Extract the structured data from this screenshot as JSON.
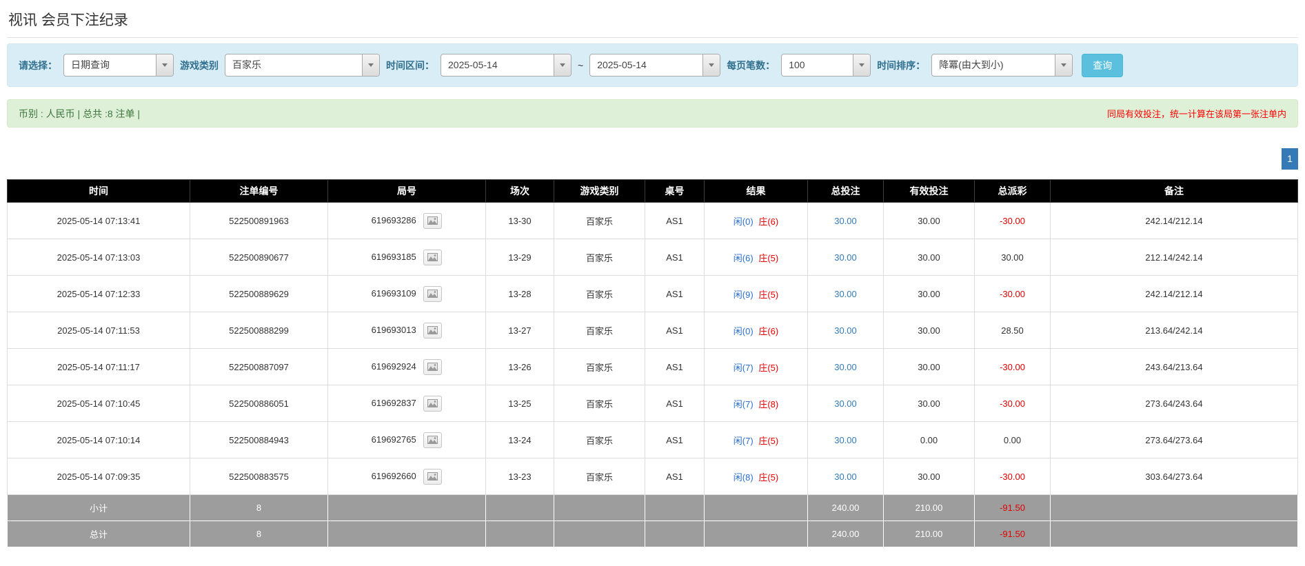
{
  "page": {
    "title": "视讯 会员下注纪录"
  },
  "filters": {
    "select_label": "请选择：",
    "select_value": "日期查询",
    "game_type_label": "游戏类别",
    "game_type_value": "百家乐",
    "date_range_label": "时间区间：",
    "date_from": "2025-05-14",
    "tilde": "~",
    "date_to": "2025-05-14",
    "per_page_label": "每页笔数：",
    "per_page_value": "100",
    "sort_label": "时间排序：",
    "sort_value": "降冪(由大到小)",
    "search_button": "查询"
  },
  "summary": {
    "left": "币别 : 人民币 | 总共 :8 注单 |",
    "right": "同局有效投注，统一计算在该局第一张注单内"
  },
  "pagination": {
    "current": "1"
  },
  "table": {
    "headers": [
      "时间",
      "注单编号",
      "局号",
      "场次",
      "游戏类别",
      "桌号",
      "结果",
      "总投注",
      "有效投注",
      "总派彩",
      "备注"
    ],
    "rows": [
      {
        "time": "2025-05-14 07:13:41",
        "bet_id": "522500891963",
        "round": "619693286",
        "session": "13-30",
        "game": "百家乐",
        "table_no": "AS1",
        "result_player": "闲(0)",
        "result_banker": "庄(6)",
        "total_bet": "30.00",
        "valid_bet": "30.00",
        "payout": "-30.00",
        "note": "242.14/212.14"
      },
      {
        "time": "2025-05-14 07:13:03",
        "bet_id": "522500890677",
        "round": "619693185",
        "session": "13-29",
        "game": "百家乐",
        "table_no": "AS1",
        "result_player": "闲(6)",
        "result_banker": "庄(5)",
        "total_bet": "30.00",
        "valid_bet": "30.00",
        "payout": "30.00",
        "note": "212.14/242.14"
      },
      {
        "time": "2025-05-14 07:12:33",
        "bet_id": "522500889629",
        "round": "619693109",
        "session": "13-28",
        "game": "百家乐",
        "table_no": "AS1",
        "result_player": "闲(9)",
        "result_banker": "庄(5)",
        "total_bet": "30.00",
        "valid_bet": "30.00",
        "payout": "-30.00",
        "note": "242.14/212.14"
      },
      {
        "time": "2025-05-14 07:11:53",
        "bet_id": "522500888299",
        "round": "619693013",
        "session": "13-27",
        "game": "百家乐",
        "table_no": "AS1",
        "result_player": "闲(0)",
        "result_banker": "庄(6)",
        "total_bet": "30.00",
        "valid_bet": "30.00",
        "payout": "28.50",
        "note": "213.64/242.14"
      },
      {
        "time": "2025-05-14 07:11:17",
        "bet_id": "522500887097",
        "round": "619692924",
        "session": "13-26",
        "game": "百家乐",
        "table_no": "AS1",
        "result_player": "闲(7)",
        "result_banker": "庄(5)",
        "total_bet": "30.00",
        "valid_bet": "30.00",
        "payout": "-30.00",
        "note": "243.64/213.64"
      },
      {
        "time": "2025-05-14 07:10:45",
        "bet_id": "522500886051",
        "round": "619692837",
        "session": "13-25",
        "game": "百家乐",
        "table_no": "AS1",
        "result_player": "闲(7)",
        "result_banker": "庄(8)",
        "total_bet": "30.00",
        "valid_bet": "30.00",
        "payout": "-30.00",
        "note": "273.64/243.64"
      },
      {
        "time": "2025-05-14 07:10:14",
        "bet_id": "522500884943",
        "round": "619692765",
        "session": "13-24",
        "game": "百家乐",
        "table_no": "AS1",
        "result_player": "闲(7)",
        "result_banker": "庄(5)",
        "total_bet": "30.00",
        "valid_bet": "0.00",
        "payout": "0.00",
        "note": "273.64/273.64"
      },
      {
        "time": "2025-05-14 07:09:35",
        "bet_id": "522500883575",
        "round": "619692660",
        "session": "13-23",
        "game": "百家乐",
        "table_no": "AS1",
        "result_player": "闲(8)",
        "result_banker": "庄(5)",
        "total_bet": "30.00",
        "valid_bet": "30.00",
        "payout": "-30.00",
        "note": "303.64/273.64"
      }
    ],
    "subtotal": {
      "label": "小计",
      "count": "8",
      "total_bet": "240.00",
      "valid_bet": "210.00",
      "payout": "-91.50"
    },
    "total": {
      "label": "总计",
      "count": "8",
      "total_bet": "240.00",
      "valid_bet": "210.00",
      "payout": "-91.50"
    }
  }
}
